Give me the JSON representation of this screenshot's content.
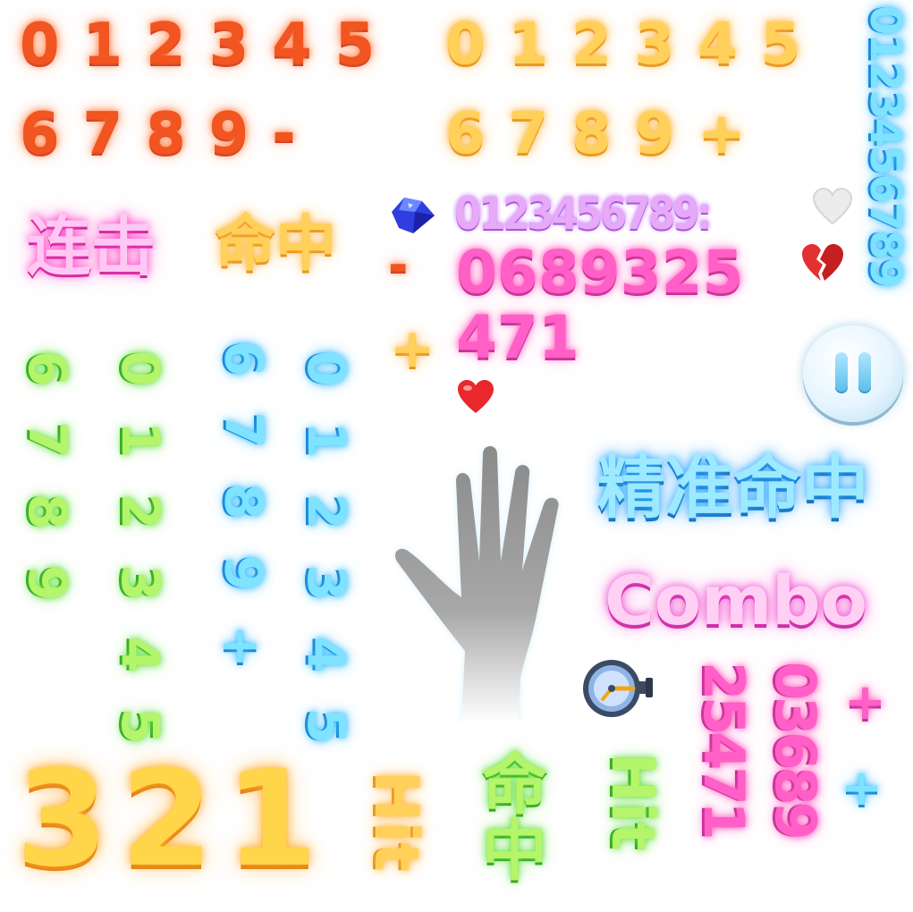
{
  "red_digits_row1": [
    "0",
    "1",
    "2",
    "3",
    "4",
    "5"
  ],
  "red_digits_row2": [
    "6",
    "7",
    "8",
    "9",
    "-"
  ],
  "gold_digits_row1": [
    "0",
    "1",
    "2",
    "3",
    "4",
    "5"
  ],
  "gold_digits_row2": [
    "6",
    "7",
    "8",
    "9",
    "+"
  ],
  "cyan_vertical_digits": "0123456789",
  "label_combo_cn": "连击",
  "label_hit_cn": "命中",
  "purple_digits": "0123456789:",
  "pink_digits_line1": "0689325",
  "pink_digits_line2": "471",
  "minus_symbol": "-",
  "plus_symbol_gold": "+",
  "green_col1": [
    "6",
    "7",
    "8",
    "9"
  ],
  "green_col2": [
    "0",
    "1",
    "2",
    "3",
    "4",
    "5"
  ],
  "blue_col1": [
    "6",
    "7",
    "8",
    "9",
    "+"
  ],
  "blue_col2": [
    "0",
    "1",
    "2",
    "3",
    "4",
    "5"
  ],
  "label_precise_hit": "精准命中",
  "label_combo": "Combo",
  "big_number": "321",
  "hit_gold": "Hit",
  "hit_green_cn": "命中",
  "hit_green": "Hit",
  "pink_vertical_col1": "25471",
  "pink_vertical_col2": "03689",
  "pink_plus": "+",
  "blue_plus": "+",
  "icons": [
    "gem-icon",
    "heart-gray-icon",
    "heart-broken-icon",
    "heart-red-icon",
    "pause-icon",
    "hand-icon",
    "stopwatch-icon"
  ],
  "colors": {
    "red": "#f2551f",
    "gold": "#ffd15a",
    "pink": "#ff5fc6",
    "cyan": "#7fe3ff",
    "green": "#b5f56b",
    "purple": "#e6aaf6"
  }
}
